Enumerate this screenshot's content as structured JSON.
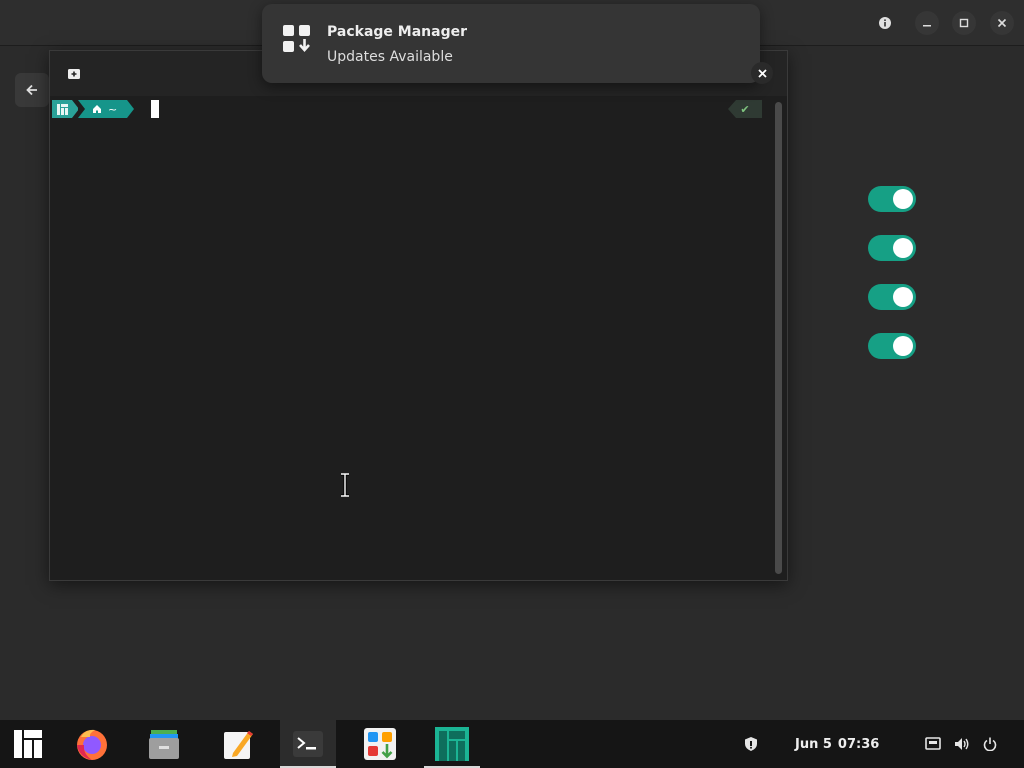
{
  "notification": {
    "title": "Package Manager",
    "body": "Updates Available",
    "icon": "package-manager-icon"
  },
  "settings_window": {
    "toggles": [
      {
        "name": "toggle-1",
        "state": true
      },
      {
        "name": "toggle-2",
        "state": true
      },
      {
        "name": "toggle-3",
        "state": true
      },
      {
        "name": "toggle-4",
        "state": true
      }
    ]
  },
  "terminal": {
    "prompt_path": "~",
    "status": "✔"
  },
  "taskbar": {
    "apps": [
      "manjaro-menu-icon",
      "firefox-icon",
      "files-icon",
      "text-editor-icon",
      "terminal-icon",
      "software-center-icon",
      "manjaro-hello-icon"
    ],
    "date": "Jun 5",
    "time": "07:36"
  },
  "colors": {
    "accent": "#16a085",
    "taskbar": "#151515",
    "terminal_bg": "#1e1e1e"
  }
}
